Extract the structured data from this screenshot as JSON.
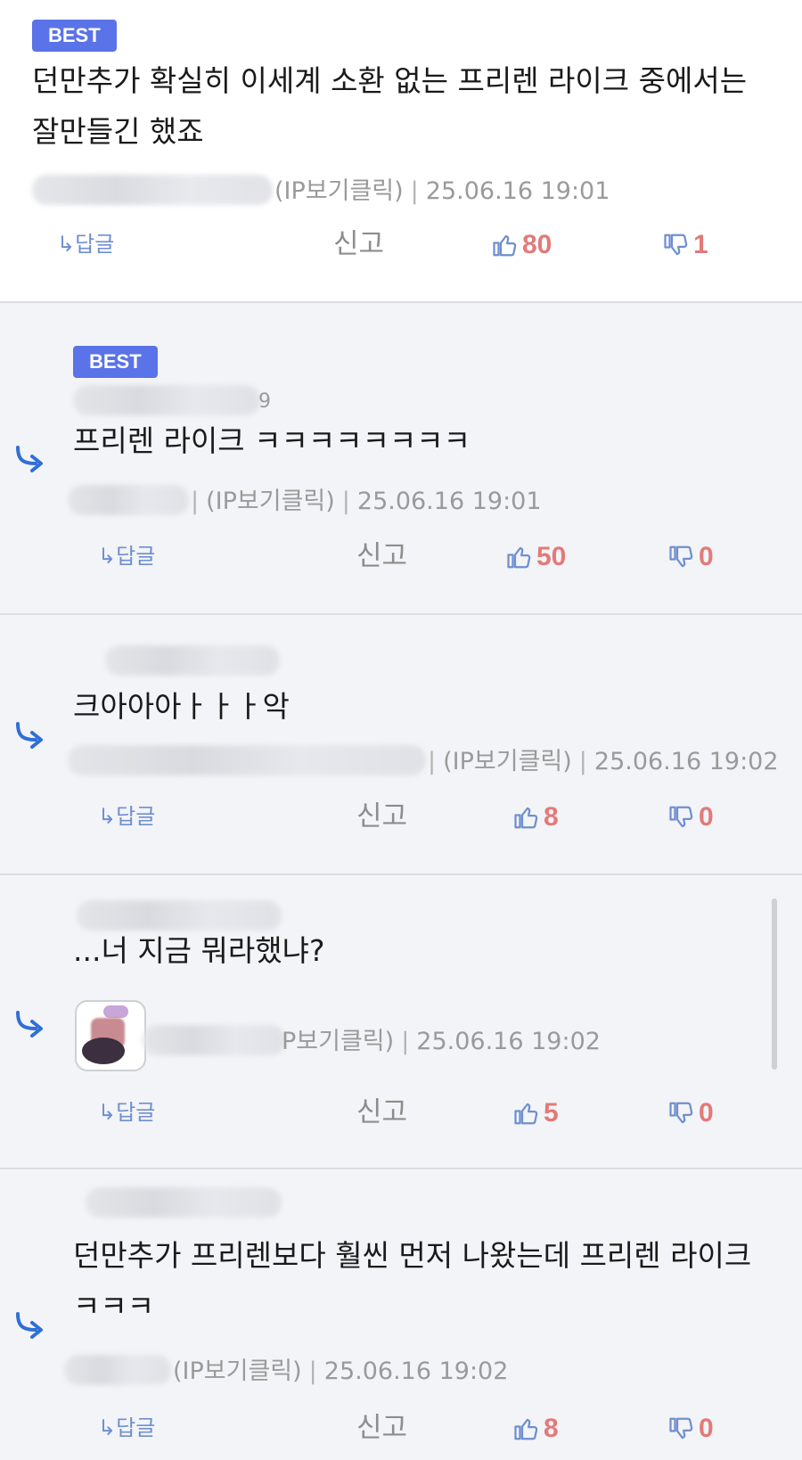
{
  "comments": [
    {
      "badge": "BEST",
      "text": "던만추가 확실히 이세계 소환 없는 프리렌 라이크 중에서는 잘만들긴 했죠",
      "meta_ip": "(IP보기클릭)",
      "meta_date": "25.06.16 19:01",
      "reply_label": "↳답글",
      "report_label": "신고",
      "likes": "80",
      "dislikes": "1"
    },
    {
      "badge": "BEST",
      "nick_tail": "9",
      "text": "프리렌 라이크 ㅋㅋㅋㅋㅋㅋㅋㅋ",
      "meta_ip": "(IP보기클릭)",
      "meta_date": "25.06.16 19:01",
      "reply_label": "↳답글",
      "report_label": "신고",
      "likes": "50",
      "dislikes": "0"
    },
    {
      "text": "크아아아ㅏㅏㅏ악",
      "meta_ip": "(IP보기클릭)",
      "meta_date": "25.06.16 19:02",
      "reply_label": "↳답글",
      "report_label": "신고",
      "likes": "8",
      "dislikes": "0"
    },
    {
      "text": "...너 지금 뭐라했냐?",
      "meta_ip": "P보기클릭)",
      "meta_date": "25.06.16 19:02",
      "reply_label": "↳답글",
      "report_label": "신고",
      "likes": "5",
      "dislikes": "0"
    },
    {
      "text": "던만추가 프리렌보다 훨씬 먼저 나왔는데 프리렌 라이크 ㅋㅋㅋ",
      "meta_ip": "(IP보기클릭)",
      "meta_date": "25.06.16 19:02",
      "reply_label": "↳답글",
      "report_label": "신고",
      "likes": "8",
      "dislikes": "0"
    }
  ],
  "colors": {
    "badge": "#5a73e8",
    "count": "#e27a7a",
    "thumb": "#6f8fd1",
    "reply_arrow": "#2f6fd6"
  },
  "icons": {
    "reply_arrow": "reply-arrow-icon",
    "like": "thumbs-up-icon",
    "dislike": "thumbs-down-icon"
  }
}
